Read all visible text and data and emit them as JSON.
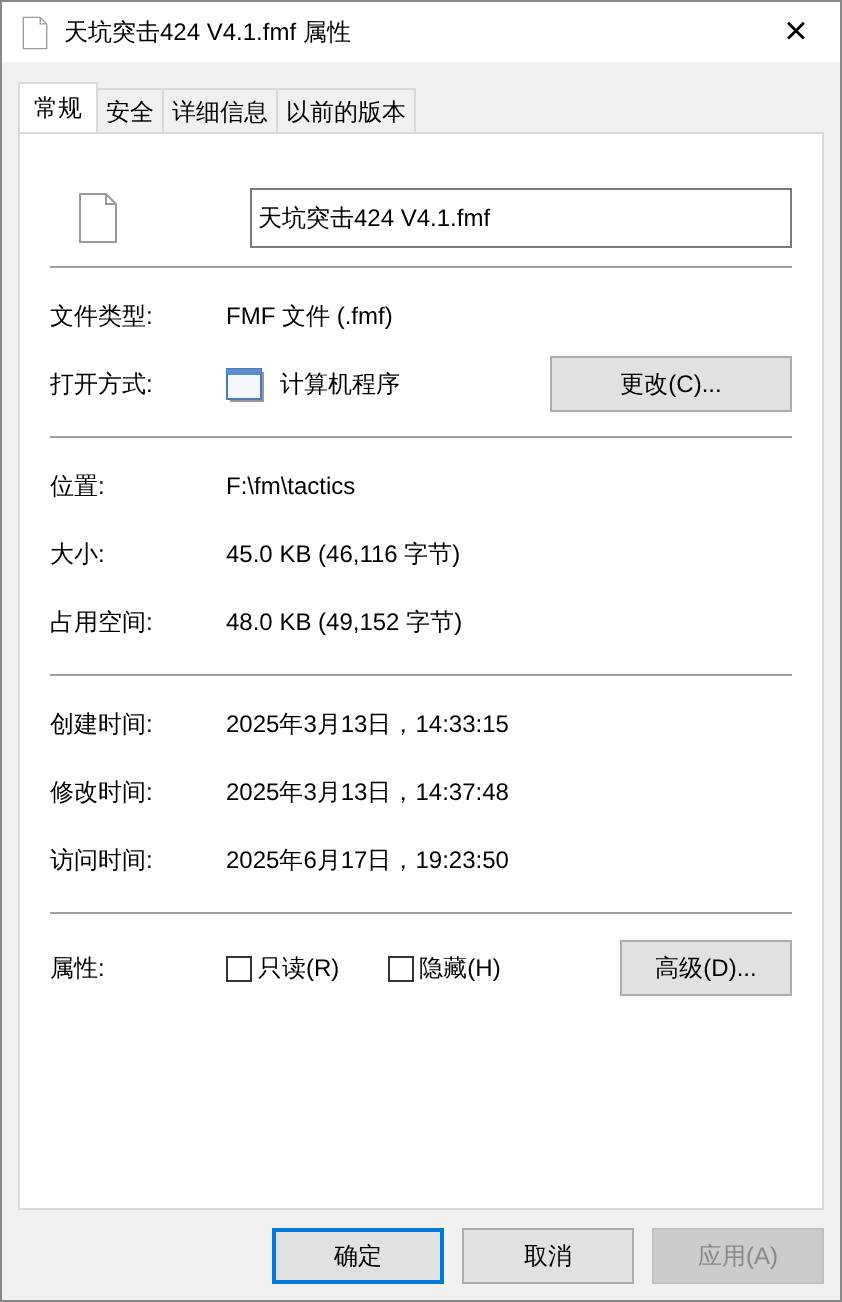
{
  "window": {
    "title": "天坑突击424 V4.1.fmf 属性",
    "close": "×"
  },
  "tabs": [
    {
      "label": "常规",
      "selected": true
    },
    {
      "label": "安全",
      "selected": false
    },
    {
      "label": "详细信息",
      "selected": false
    },
    {
      "label": "以前的版本",
      "selected": false
    }
  ],
  "file_name": "天坑突击424 V4.1.fmf",
  "sections": [
    {
      "rows": [
        {
          "kind": "text",
          "label": "文件类型:",
          "value": "FMF 文件 (.fmf)"
        },
        {
          "kind": "open_with",
          "label": "打开方式:",
          "value": "计算机程序",
          "button": "更改(C)..."
        }
      ]
    },
    {
      "rows": [
        {
          "kind": "text",
          "label": "位置:",
          "value": "F:\\fm\\tactics"
        },
        {
          "kind": "text",
          "label": "大小:",
          "value": "45.0 KB (46,116 字节)"
        },
        {
          "kind": "text",
          "label": "占用空间:",
          "value": "48.0 KB (49,152 字节)"
        }
      ]
    },
    {
      "rows": [
        {
          "kind": "text",
          "label": "创建时间:",
          "value": "2025年3月13日，14:33:15"
        },
        {
          "kind": "text",
          "label": "修改时间:",
          "value": "2025年3月13日，14:37:48"
        },
        {
          "kind": "text",
          "label": "访问时间:",
          "value": "2025年6月17日，19:23:50"
        }
      ]
    }
  ],
  "attributes": {
    "label": "属性:",
    "checkboxes": [
      {
        "label": "只读(R)",
        "checked": false
      },
      {
        "label": "隐藏(H)",
        "checked": false
      }
    ],
    "button": "高级(D)..."
  },
  "buttons": [
    {
      "label": "确定",
      "default": true,
      "disabled": false
    },
    {
      "label": "取消",
      "default": false,
      "disabled": false
    },
    {
      "label": "应用(A)",
      "default": false,
      "disabled": true
    }
  ]
}
